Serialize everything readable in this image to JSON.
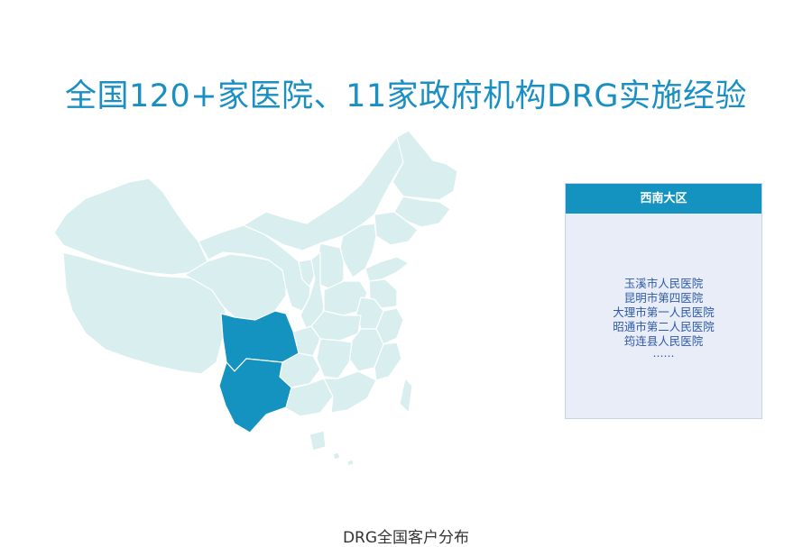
{
  "page": {
    "title": "全国120+家医院、11家政府机构DRG实施经验",
    "caption": "DRG全国客户分布"
  },
  "map": {
    "base_color": "#d9eeee",
    "border_color": "#ffffff",
    "highlight_color": "#1593c0",
    "highlighted_regions": [
      "sichuan",
      "yunnan"
    ]
  },
  "region_panel": {
    "header": "西南大区",
    "header_color": "#1593c0",
    "background_color": "#e8edf7",
    "hospitals": [
      "玉溪市人民医院",
      "昆明市第四医院",
      "大理市第一人民医院",
      "昭通市第二人民医院",
      "筠连县人民医院"
    ],
    "more": "……"
  },
  "colors": {
    "title": "#1a8fc4",
    "list_text": "#2f5aa8",
    "caption": "#333333"
  }
}
